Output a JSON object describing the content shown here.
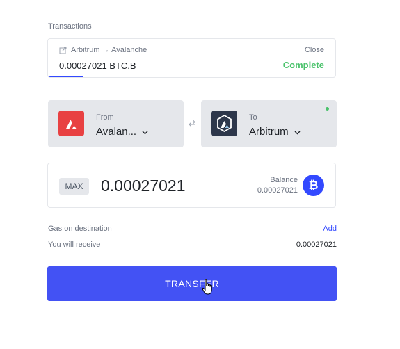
{
  "transactions": {
    "title": "Transactions",
    "route": "Arbitrum → Avalanche",
    "amount": "0.00027021 BTC.B",
    "close_label": "Close",
    "status": "Complete",
    "progress": 0.12
  },
  "from": {
    "label": "From",
    "chain": "Avalan...",
    "icon": "avalanche-logo"
  },
  "to": {
    "label": "To",
    "chain": "Arbitrum",
    "icon": "arbitrum-logo"
  },
  "swap_icon": "⇄",
  "amount": {
    "max_label": "MAX",
    "value": "0.00027021",
    "balance_label": "Balance",
    "balance_value": "0.00027021",
    "token_symbol": "₿",
    "token_icon": "bitcoin-icon"
  },
  "gas": {
    "label": "Gas on destination",
    "action": "Add"
  },
  "receive": {
    "label": "You will receive",
    "value": "0.00027021"
  },
  "transfer": {
    "label": "TRANSFER"
  },
  "colors": {
    "accent": "#4352f4",
    "success": "#4ac26b",
    "avalanche": "#e84142",
    "arbitrum": "#2d374b"
  }
}
